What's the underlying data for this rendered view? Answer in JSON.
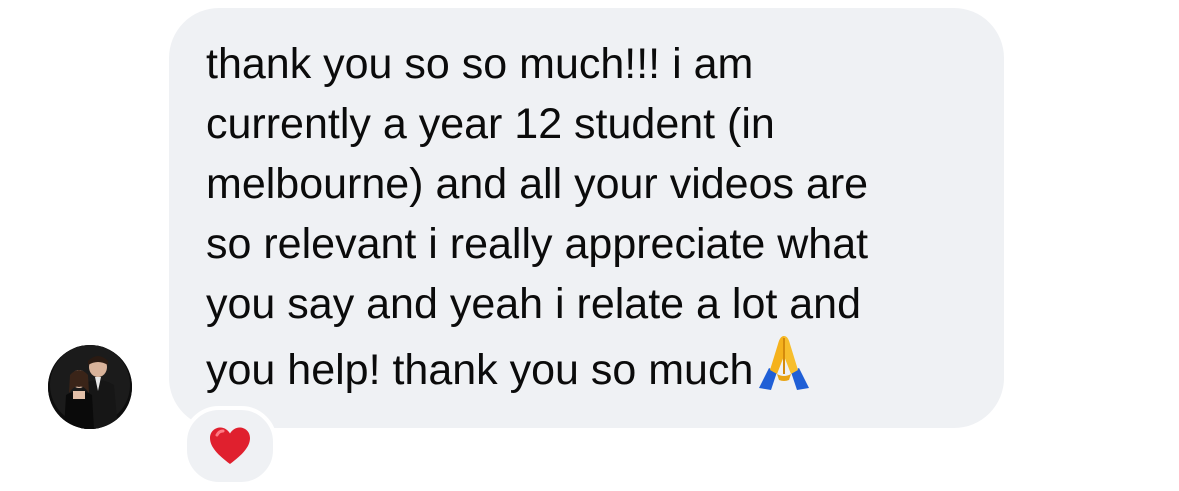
{
  "message": {
    "lines": [
      "thank you so so much!!! i am",
      "currently a year 12 student (in",
      "melbourne) and all your videos are",
      "so relevant i really appreciate what",
      "you say and yeah i relate a lot and",
      "you help! thank you so much"
    ],
    "trailing_emoji": "folded-hands-icon"
  },
  "sender": {
    "avatar": "profile-photo"
  },
  "reaction": {
    "emoji": "red-heart-icon"
  },
  "colors": {
    "bubble": "#eff1f4",
    "text": "#0b0b0b",
    "heart": "#e0202e"
  }
}
